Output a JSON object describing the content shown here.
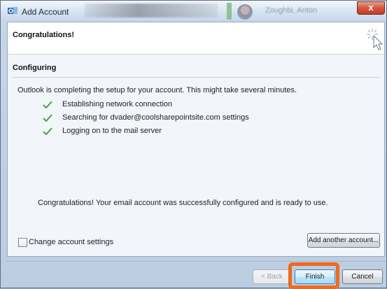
{
  "window": {
    "title": "Add Account",
    "close_glyph": "x",
    "background_title": "Zoughbi, Anton"
  },
  "header": {
    "heading": "Congratulations!",
    "icon": "wizard-sparkle-icon"
  },
  "configuring": {
    "title": "Configuring",
    "status": "Outlook is completing the setup for your account. This might take several minutes.",
    "steps": [
      {
        "label": "Establishing network connection",
        "state": "done"
      },
      {
        "label": "Searching for dvader@coolsharepointsite.com settings",
        "state": "done"
      },
      {
        "label": "Logging on to the mail server",
        "state": "done"
      }
    ],
    "success_message": "Congratulations! Your email account was successfully configured and is ready to use."
  },
  "options": {
    "change_settings_label": "Change account settings",
    "change_settings_checked": false,
    "add_another_label": "Add another account..."
  },
  "footer": {
    "back_label": "< Back",
    "finish_label": "Finish",
    "cancel_label": "Cancel"
  },
  "colors": {
    "check": "#4aa14a",
    "highlight": "#ee6a1e",
    "close": "#c43b25"
  }
}
